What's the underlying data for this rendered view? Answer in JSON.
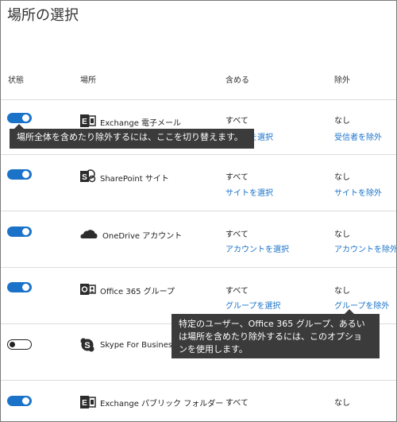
{
  "page": {
    "title": "場所の選択"
  },
  "columns": {
    "status": "状態",
    "location": "場所",
    "include": "含める",
    "exclude": "除外"
  },
  "rows": [
    {
      "name": "Exchange 電子メール",
      "include": "すべて",
      "include_link": "受信者を選択",
      "exclude": "なし",
      "exclude_link": "受信者を除外",
      "toggle": "on",
      "icon": "exchange-icon"
    },
    {
      "name": "SharePoint サイト",
      "include": "すべて",
      "include_link": "サイトを選択",
      "exclude": "なし",
      "exclude_link": "サイトを除外",
      "toggle": "on",
      "icon": "sharepoint-icon"
    },
    {
      "name": "OneDrive アカウント",
      "include": "すべて",
      "include_link": "アカウントを選択",
      "exclude": "なし",
      "exclude_link": "アカウントを除外",
      "toggle": "on",
      "icon": "onedrive-icon"
    },
    {
      "name": "Office 365 グループ",
      "include": "すべて",
      "include_link": "グループを選択",
      "exclude": "なし",
      "exclude_link": "グループを除外",
      "toggle": "on",
      "icon": "office365-groups-icon"
    },
    {
      "name": "Skype For Business",
      "include": "",
      "include_link": "",
      "exclude": "",
      "exclude_link": "",
      "toggle": "off",
      "icon": "skype-icon"
    },
    {
      "name": "Exchange パブリック フォルダー",
      "include": "すべて",
      "include_link": "",
      "exclude": "なし",
      "exclude_link": "",
      "toggle": "on",
      "icon": "exchange-icon"
    }
  ],
  "tooltips": {
    "toggle_hint": "場所全体を含めたり除外するには、ここを切り替えます。",
    "exclude_hint_lines": [
      "特定のユーザー、Office 365 グループ、あるい",
      "は場所を含めたり除外するには、このオプショ",
      "ンを使用します。"
    ]
  },
  "colors": {
    "accent": "#1a73c9",
    "tooltip_bg": "#3b3b3b"
  }
}
